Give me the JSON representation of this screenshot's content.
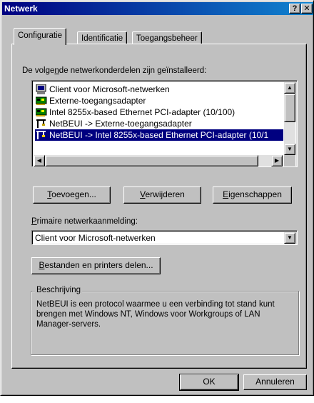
{
  "window": {
    "title": "Netwerk",
    "help_button": "?",
    "close_button": "✕"
  },
  "tabs": [
    {
      "label": "Configuratie",
      "active": true
    },
    {
      "label": "Identificatie",
      "active": false
    },
    {
      "label": "Toegangsbeheer",
      "active": false
    }
  ],
  "components": {
    "label_pre": "De volge",
    "label_mn": "n",
    "label_post": "de netwerkonderdelen zijn geïnstalleerd:",
    "items": [
      {
        "label": "Client voor Microsoft-netwerken",
        "icon": "computer-icon",
        "selected": false
      },
      {
        "label": "Externe-toegangsadapter",
        "icon": "network-card-icon",
        "selected": false
      },
      {
        "label": "Intel 8255x-based Ethernet PCI-adapter (10/100)",
        "icon": "network-card-icon",
        "selected": false
      },
      {
        "label": "NetBEUI -> Externe-toegangsadapter",
        "icon": "protocol-icon",
        "selected": false
      },
      {
        "label": "NetBEUI -> Intel 8255x-based Ethernet PCI-adapter (10/1",
        "icon": "protocol-icon",
        "selected": true
      }
    ]
  },
  "buttons": {
    "add": {
      "mn": "T",
      "rest": "oevoegen..."
    },
    "remove": {
      "mn": "V",
      "rest": "erwijderen"
    },
    "properties": {
      "mn": "E",
      "rest": "igenschappen"
    },
    "sharing": {
      "mn": "B",
      "rest": "estanden en printers delen..."
    },
    "ok": "OK",
    "cancel": "Annuleren"
  },
  "primary_logon": {
    "label_mn": "P",
    "label_rest": "rimaire netwerkaanmelding:",
    "value": "Client voor Microsoft-netwerken"
  },
  "description": {
    "legend": "Beschrijving",
    "text": "NetBEUI is een protocol waarmee u een verbinding tot stand kunt brengen met Windows NT, Windows voor Workgroups of LAN Manager-servers."
  },
  "colors": {
    "title_start": "#000080",
    "title_end": "#1084d0",
    "selection": "#000080",
    "face": "#c0c0c0"
  }
}
